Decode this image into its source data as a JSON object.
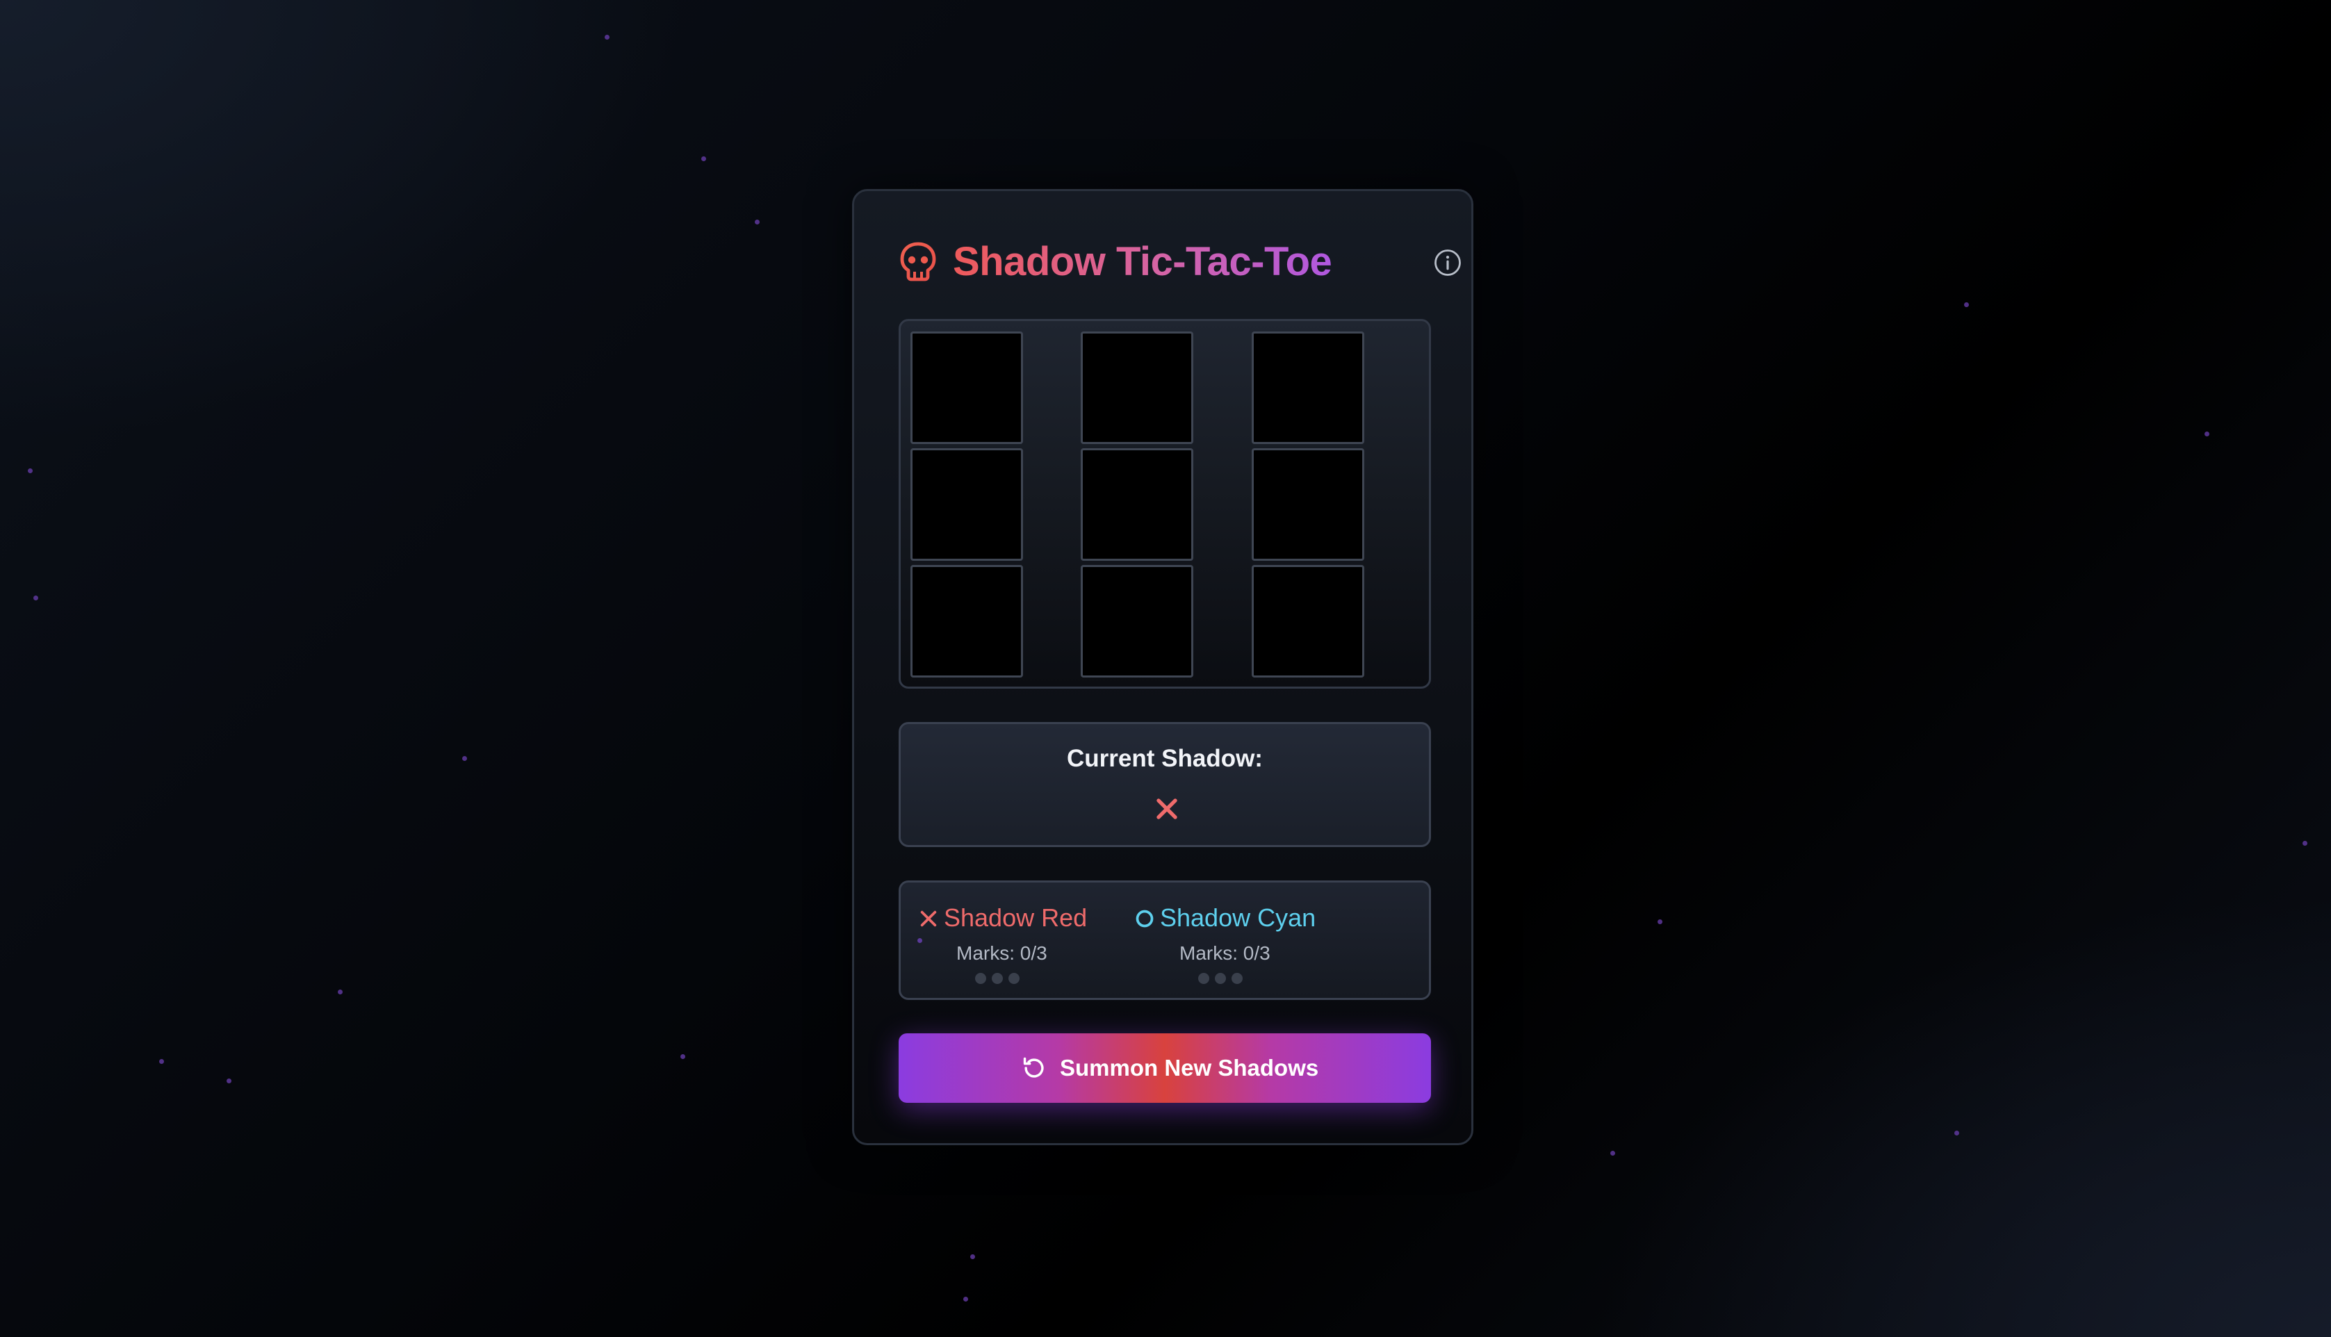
{
  "header": {
    "title": "Shadow Tic-Tac-Toe",
    "logo_icon": "skull-icon",
    "info_icon": "info-icon"
  },
  "board": {
    "cells": [
      "",
      "",
      "",
      "",
      "",
      "",
      "",
      "",
      ""
    ]
  },
  "current": {
    "label": "Current Shadow:",
    "symbol": "X",
    "symbol_icon": "x-icon"
  },
  "players": [
    {
      "name": "Shadow Red",
      "symbol": "X",
      "icon": "x-icon",
      "marks": "Marks: 0/3",
      "marks_used": 0,
      "marks_max": 3,
      "color": "#ef6b6b"
    },
    {
      "name": "Shadow Cyan",
      "symbol": "O",
      "icon": "o-icon",
      "marks": "Marks: 0/3",
      "marks_used": 0,
      "marks_max": 3,
      "color": "#5ed0ee"
    }
  ],
  "actions": {
    "summon_label": "Summon New Shadows",
    "summon_icon": "refresh-icon"
  },
  "colors": {
    "accent_purple": "#8b3ce0",
    "accent_red": "#d8423e",
    "title_start": "#ef5a5a",
    "title_end": "#b058e0"
  }
}
